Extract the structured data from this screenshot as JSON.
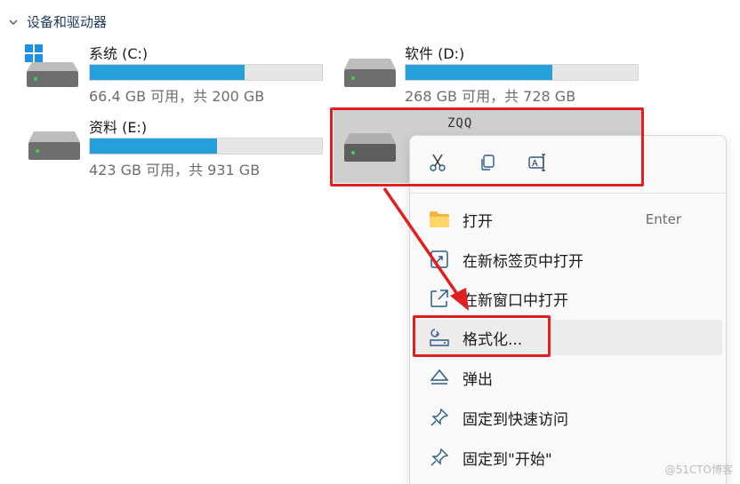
{
  "section": {
    "title": "设备和驱动器"
  },
  "drives": [
    {
      "name": "系统 (C:)",
      "info": "66.4 GB 可用，共 200 GB",
      "used_fraction": 0.668,
      "icon": "windows-drive-icon"
    },
    {
      "name": "软件 (D:)",
      "info": "268 GB 可用，共 728 GB",
      "used_fraction": 0.632,
      "icon": "hard-drive-icon"
    },
    {
      "name": "资料 (E:)",
      "info": "423 GB 可用，共 931 GB",
      "used_fraction": 0.546,
      "icon": "hard-drive-icon"
    },
    {
      "name": "ZQQ",
      "icon": "hard-drive-icon"
    }
  ],
  "context_menu": {
    "quick_actions": [
      {
        "icon": "cut-icon",
        "label": ""
      },
      {
        "icon": "copy-icon",
        "label": ""
      },
      {
        "icon": "rename-icon",
        "label": ""
      }
    ],
    "items": [
      {
        "label": "打开",
        "shortcut": "Enter",
        "icon": "folder-icon"
      },
      {
        "label": "在新标签页中打开",
        "shortcut": "",
        "icon": "open-new-tab-icon"
      },
      {
        "label": "在新窗口中打开",
        "shortcut": "",
        "icon": "open-new-window-icon"
      },
      {
        "label": "格式化...",
        "shortcut": "",
        "icon": "format-icon"
      },
      {
        "label": "弹出",
        "shortcut": "",
        "icon": "eject-icon"
      },
      {
        "label": "固定到快速访问",
        "shortcut": "",
        "icon": "pin-icon"
      },
      {
        "label": "固定到\"开始\"",
        "shortcut": "",
        "icon": "pin-icon"
      }
    ]
  },
  "watermark": "@51CTO博客",
  "colors": {
    "accent": "#26a0da",
    "annotation": "#e02020",
    "selection": "#cfcfcf"
  }
}
